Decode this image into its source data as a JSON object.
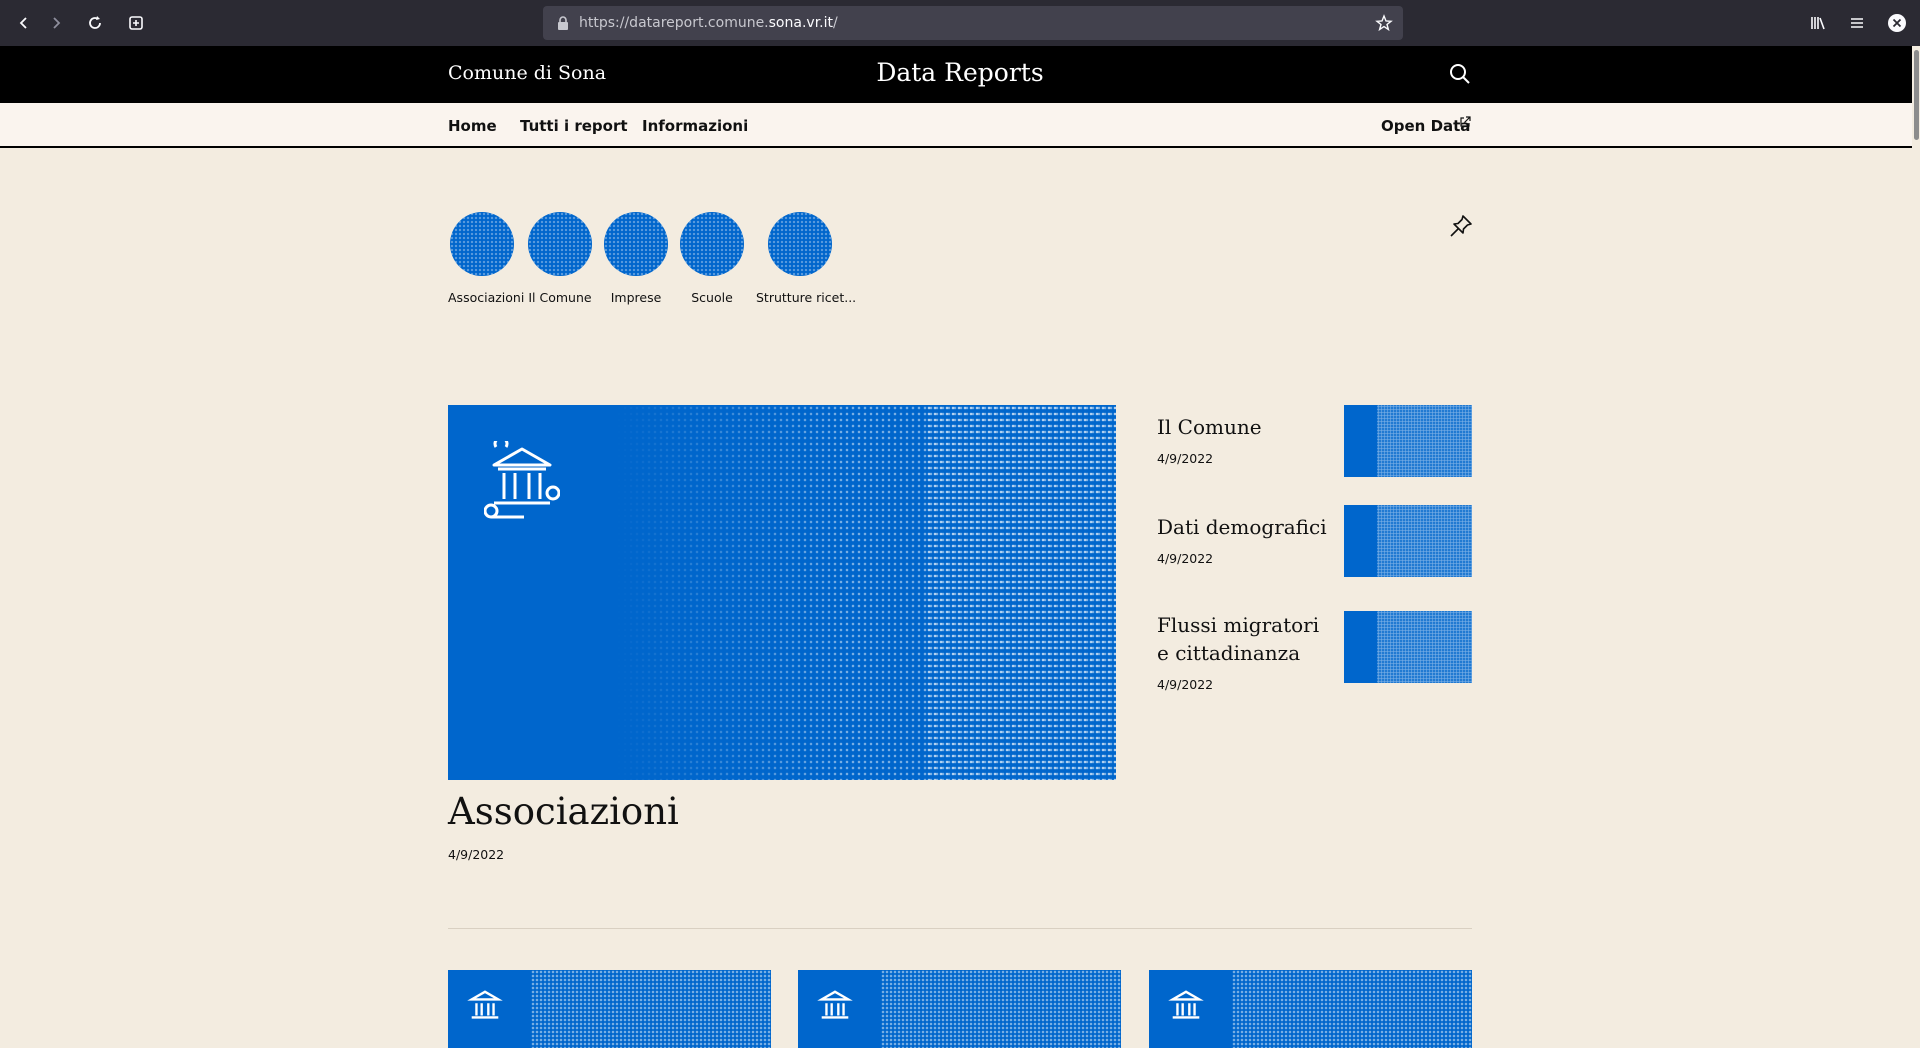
{
  "browser": {
    "url_prefix": "https://datareport.comune.",
    "url_domain": "sona.vr.it",
    "url_suffix": "/"
  },
  "header": {
    "brand": "Comune di Sona",
    "title": "Data Reports"
  },
  "nav": {
    "home": "Home",
    "all_reports": "Tutti i report",
    "info": "Informazioni",
    "open_data": "Open Data"
  },
  "categories": [
    {
      "label": "Associazioni"
    },
    {
      "label": "Il Comune"
    },
    {
      "label": "Imprese"
    },
    {
      "label": "Scuole"
    },
    {
      "label": "Strutture ricet..."
    }
  ],
  "featured": {
    "title": "Associazioni",
    "date": "4/9/2022"
  },
  "side_reports": [
    {
      "title": "Il Comune",
      "date": "4/9/2022"
    },
    {
      "title": "Dati demografici",
      "date": "4/9/2022"
    },
    {
      "title": "Flussi migratori e cittadinanza",
      "date": "4/9/2022"
    }
  ],
  "colors": {
    "accent_blue": "#0066cc",
    "page_bg": "#f3ece0",
    "header_bg": "#000000"
  }
}
